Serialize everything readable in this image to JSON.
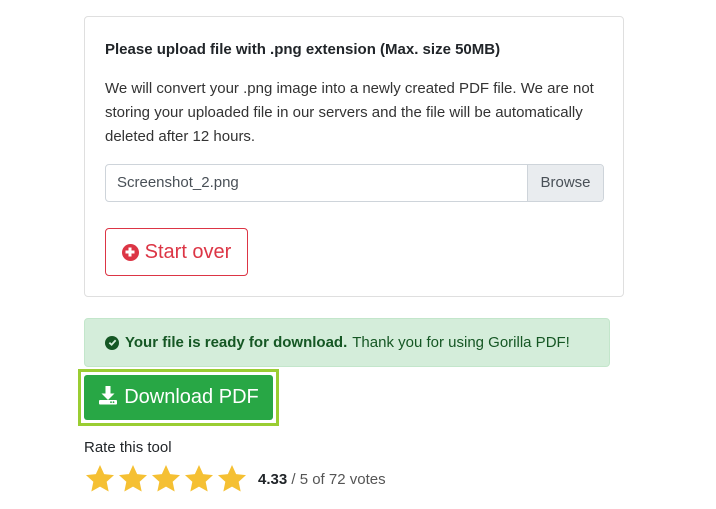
{
  "upload_card": {
    "title": "Please upload file with .png extension (Max. size 50MB)",
    "description": "We will convert your .png image into a newly created PDF file. We are not storing your uploaded file in our servers and the file will be automatically deleted after 12 hours.",
    "file_name": "Screenshot_2.png",
    "browse_label": "Browse",
    "start_over_label": "Start over",
    "start_over_icon": "plus-circle-icon"
  },
  "alert": {
    "strong_text": "Your file is ready for download.",
    "text": "Thank you for using Gorilla PDF!",
    "icon": "check-circle-icon",
    "color": "#155724",
    "background": "#d4edda"
  },
  "download": {
    "label": "Download PDF",
    "icon": "download-icon",
    "color": "#28a745",
    "highlight_color": "#9acd32"
  },
  "rating": {
    "label": "Rate this tool",
    "value": "4.33",
    "suffix": "/ 5 of 72 votes",
    "stars": 5,
    "star_color": "#f5c033"
  }
}
